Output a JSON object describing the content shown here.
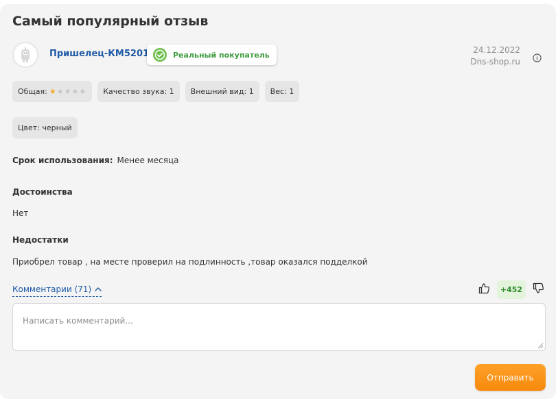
{
  "review": {
    "heading": "Самый популярный отзыв",
    "author": "Пришелец-КМ52016",
    "verified_label": "Реальный покупатель",
    "date": "24.12.2022",
    "source": "Dns-shop.ru",
    "ratings": {
      "overall_label": "Общая:",
      "overall_stars": 1,
      "max_stars": 5,
      "sound": "Качество звука: 1",
      "appearance": "Внешний вид: 1",
      "weight": "Вес: 1"
    },
    "color_chip": "Цвет: черный",
    "usage_label": "Срок использования:",
    "usage_value": "Менее месяца",
    "pros_title": "Достоинства",
    "pros_text": "Нет",
    "cons_title": "Недостатки",
    "cons_text": "Приобрел товар , на месте проверил на подлинность ,товар оказался подделкой"
  },
  "comments": {
    "toggle_label": "Комментарии (71)",
    "placeholder": "Написать комментарий...",
    "submit_label": "Отправить"
  },
  "votes": {
    "score": "+452"
  },
  "colors": {
    "author_link": "#1f5aa6",
    "verified_green": "#3f9c3f",
    "score_bg": "#e3f3dc",
    "score_text": "#2f8a2f",
    "accent_orange": "#f58a0c",
    "star_on": "#f5a623"
  },
  "icons": {
    "verified": "check-badge-icon",
    "info": "info-icon",
    "like": "thumbs-up-icon",
    "dislike": "thumbs-down-icon",
    "toggle": "chevron-up-icon"
  }
}
